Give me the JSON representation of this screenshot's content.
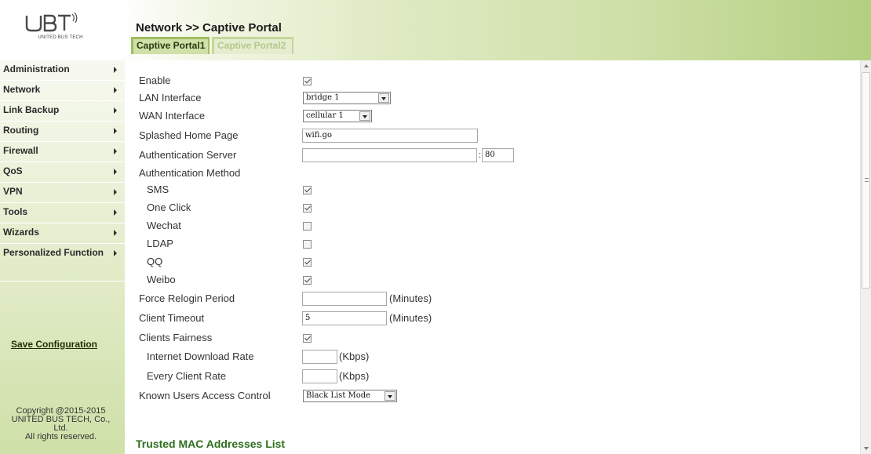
{
  "brand": {
    "logo_text": "UBT",
    "company": "UNITED BUS TECH"
  },
  "header": {
    "breadcrumb": "Network >> Captive Portal",
    "tabs": [
      {
        "label": "Captive Portal1",
        "active": true
      },
      {
        "label": "Captive Portal2",
        "active": false
      }
    ]
  },
  "sidebar": {
    "items": [
      {
        "label": "Administration"
      },
      {
        "label": "Network"
      },
      {
        "label": "Link Backup"
      },
      {
        "label": "Routing"
      },
      {
        "label": "Firewall"
      },
      {
        "label": "QoS"
      },
      {
        "label": "VPN"
      },
      {
        "label": "Tools"
      },
      {
        "label": "Wizards"
      },
      {
        "label": "Personalized Function"
      }
    ],
    "save_label": "Save Configuration",
    "copyright": [
      "Copyright @2015-2015",
      "UNITED BUS TECH, Co.,",
      "Ltd.",
      "All rights reserved."
    ]
  },
  "form": {
    "enable": {
      "label": "Enable",
      "checked": true
    },
    "lan_interface": {
      "label": "LAN Interface",
      "value": "bridge 1"
    },
    "wan_interface": {
      "label": "WAN Interface",
      "value": "cellular 1"
    },
    "splash_page": {
      "label": "Splashed Home Page",
      "value": "wifi.go"
    },
    "auth_server": {
      "label": "Authentication Server",
      "value": "",
      "port_sep": ":",
      "port": "80"
    },
    "auth_method": {
      "label": "Authentication Method"
    },
    "methods": [
      {
        "label": "SMS",
        "checked": true
      },
      {
        "label": "One Click",
        "checked": true
      },
      {
        "label": "Wechat",
        "checked": false
      },
      {
        "label": "LDAP",
        "checked": false
      },
      {
        "label": "QQ",
        "checked": true
      },
      {
        "label": "Weibo",
        "checked": true
      }
    ],
    "force_relogin": {
      "label": "Force Relogin Period",
      "value": "",
      "unit": "(Minutes)"
    },
    "client_timeout": {
      "label": "Client Timeout",
      "value": "5",
      "unit": "(Minutes)"
    },
    "clients_fairness": {
      "label": "Clients Fairness",
      "checked": true
    },
    "download_rate": {
      "label": "Internet Download Rate",
      "value": "",
      "unit": "(Kbps)"
    },
    "client_rate": {
      "label": "Every Client Rate",
      "value": "",
      "unit": "(Kbps)"
    },
    "known_users": {
      "label": "Known Users Access Control",
      "value": "Black List Mode"
    }
  },
  "trusted_mac": {
    "title": "Trusted MAC Addresses List"
  }
}
